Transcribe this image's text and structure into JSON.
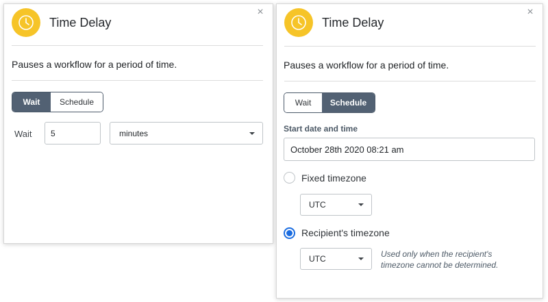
{
  "left_panel": {
    "title": "Time Delay",
    "description": "Pauses a workflow for a period of time.",
    "segmented_control": {
      "options": [
        "Wait",
        "Schedule"
      ],
      "selected": "Wait"
    },
    "wait_label": "Wait",
    "wait_value": "5",
    "unit_select_value": "minutes",
    "icons": {
      "header": "clock-icon",
      "close": "close-icon"
    }
  },
  "right_panel": {
    "title": "Time Delay",
    "description": "Pauses a workflow for a period of time.",
    "segmented_control": {
      "options": [
        "Wait",
        "Schedule"
      ],
      "selected": "Schedule"
    },
    "start_label": "Start date and time",
    "start_value": "October 28th 2020 08:21 am",
    "fixed_timezone_label": "Fixed timezone",
    "fixed_timezone_value": "UTC",
    "recipient_timezone_label": "Recipient's timezone",
    "recipient_timezone_value": "UTC",
    "recipient_note_line1": "Used only when the recipient's",
    "recipient_note_line2": "timezone cannot be determined.",
    "selected_timezone_mode": "Recipient's timezone",
    "icons": {
      "header": "clock-icon",
      "close": "close-icon"
    }
  },
  "colors": {
    "header_badge": "#f6c428",
    "segmented_active": "#526173",
    "radio_selected": "#1a6ce0"
  }
}
